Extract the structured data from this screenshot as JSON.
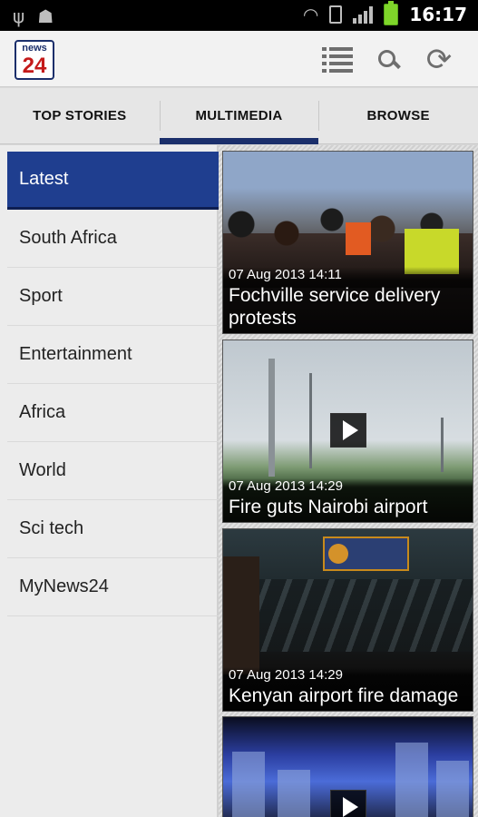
{
  "status_bar": {
    "time": "16:17",
    "left_icons": [
      "usb-icon",
      "android-debug-icon"
    ],
    "right_icons": [
      "wifi-icon",
      "sim-icon",
      "signal-icon",
      "battery-icon"
    ]
  },
  "app_bar": {
    "logo_top": "news",
    "logo_bottom": "24",
    "actions": [
      "list-icon",
      "search-icon",
      "refresh-icon"
    ]
  },
  "tabs": [
    {
      "label": "TOP STORIES",
      "active": false
    },
    {
      "label": "MULTIMEDIA",
      "active": true
    },
    {
      "label": "BROWSE",
      "active": false
    }
  ],
  "sidebar": {
    "items": [
      {
        "label": "Latest",
        "active": true
      },
      {
        "label": "South Africa"
      },
      {
        "label": "Sport"
      },
      {
        "label": "Entertainment"
      },
      {
        "label": "Africa"
      },
      {
        "label": "World"
      },
      {
        "label": "Sci tech"
      },
      {
        "label": "MyNews24"
      }
    ]
  },
  "feed": {
    "cards": [
      {
        "date": "07 Aug 2013 14:11",
        "title": "Fochville service delivery protests",
        "video": false
      },
      {
        "date": "07 Aug 2013 14:29",
        "title": "Fire guts Nairobi airport",
        "video": true
      },
      {
        "date": "07 Aug 2013 14:29",
        "title": "Kenyan airport fire damage",
        "video": false
      },
      {
        "date": "",
        "title": "",
        "video": true
      }
    ]
  },
  "colors": {
    "accent": "#1f3e8f",
    "tab_indicator": "#1b2f6b",
    "logo_red": "#c41a1a"
  }
}
